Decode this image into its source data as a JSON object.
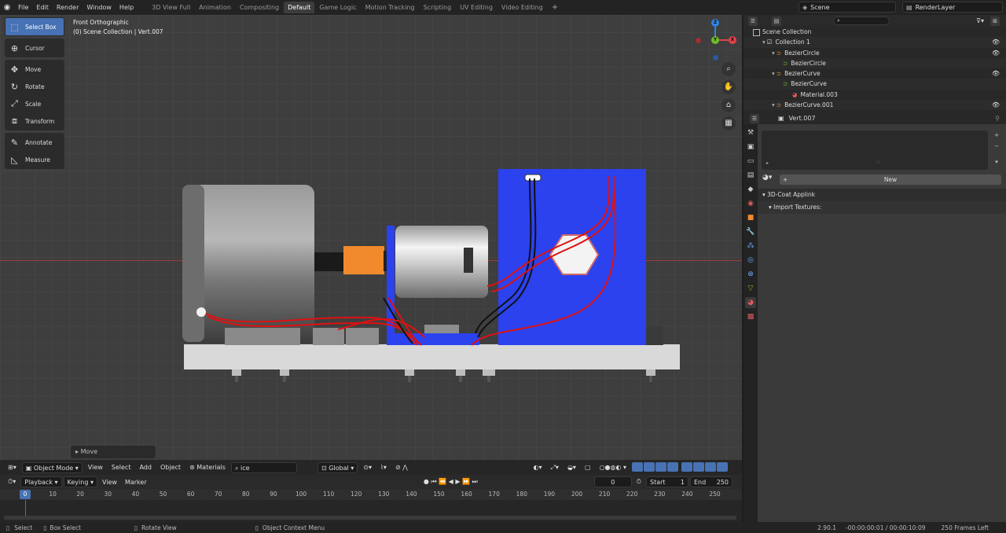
{
  "menu": [
    "File",
    "Edit",
    "Render",
    "Window",
    "Help"
  ],
  "workspaces": [
    "3D View Full",
    "Animation",
    "Compositing",
    "Default",
    "Game Logic",
    "Motion Tracking",
    "Scripting",
    "UV Editing",
    "Video Editing"
  ],
  "active_workspace": "Default",
  "scene": "Scene",
  "render_layer": "RenderLayer",
  "tools": [
    {
      "label": "Select Box",
      "icon": "select-box-icon",
      "active": true
    },
    {
      "label": "Cursor",
      "icon": "cursor-icon"
    },
    {
      "label": "Move",
      "icon": "move-icon"
    },
    {
      "label": "Rotate",
      "icon": "rotate-icon"
    },
    {
      "label": "Scale",
      "icon": "scale-icon"
    },
    {
      "label": "Transform",
      "icon": "transform-icon"
    },
    {
      "label": "Annotate",
      "icon": "annotate-icon"
    },
    {
      "label": "Measure",
      "icon": "measure-icon"
    }
  ],
  "viewport": {
    "view_name": "Front Orthographic",
    "collection_info": "(0) Scene Collection | Vert.007",
    "last_operator": "Move",
    "gizmo": {
      "x": "X",
      "y": "Y",
      "z": "Z"
    }
  },
  "header": {
    "mode": "Object Mode",
    "view": "View",
    "select": "Select",
    "add": "Add",
    "object": "Object",
    "material_search_label": "Materials",
    "search_value": "ice",
    "orientation": "Global"
  },
  "timeline": {
    "playback": "Playback",
    "keying": "Keying",
    "view": "View",
    "marker": "Marker",
    "current_frame": "0",
    "start_label": "Start",
    "start": "1",
    "end_label": "End",
    "end": "250",
    "ticks": [
      "0",
      "10",
      "20",
      "30",
      "40",
      "50",
      "60",
      "70",
      "80",
      "90",
      "100",
      "110",
      "120",
      "130",
      "140",
      "150",
      "160",
      "170",
      "180",
      "190",
      "200",
      "210",
      "220",
      "230",
      "240",
      "250"
    ]
  },
  "status": {
    "select": "Select",
    "box_select": "Box Select",
    "rotate_view": "Rotate View",
    "context_menu": "Object Context Menu",
    "version": "2.90.1",
    "time": "-00:00:00:01 / 00:00:10:09",
    "frames_left": "250 Frames Left"
  },
  "outliner": {
    "root": "Scene Collection",
    "rows": [
      {
        "label": "Collection 1",
        "indent": 1,
        "type": "collection",
        "eye": true
      },
      {
        "label": "BezierCircle",
        "indent": 2,
        "type": "curve",
        "eye": true
      },
      {
        "label": "BezierCircle",
        "indent": 3,
        "type": "curve-data",
        "eye": false
      },
      {
        "label": "BezierCurve",
        "indent": 2,
        "type": "curve",
        "eye": true
      },
      {
        "label": "BezierCurve",
        "indent": 3,
        "type": "curve-data",
        "eye": false
      },
      {
        "label": "Material.003",
        "indent": 4,
        "type": "material",
        "eye": false
      },
      {
        "label": "BezierCurve.001",
        "indent": 2,
        "type": "curve",
        "eye": true
      }
    ]
  },
  "properties": {
    "object": "Vert.007",
    "new_button": "New",
    "panel_applink": "3D-Coat Applink",
    "panel_import": "Import Textures:"
  },
  "colors": {
    "accent": "#4772b3",
    "base_plate": "#d9d9d9",
    "blue_panel": "#2b42ee",
    "wire_red": "#e01010",
    "coupler_orange": "#f08a2c"
  }
}
